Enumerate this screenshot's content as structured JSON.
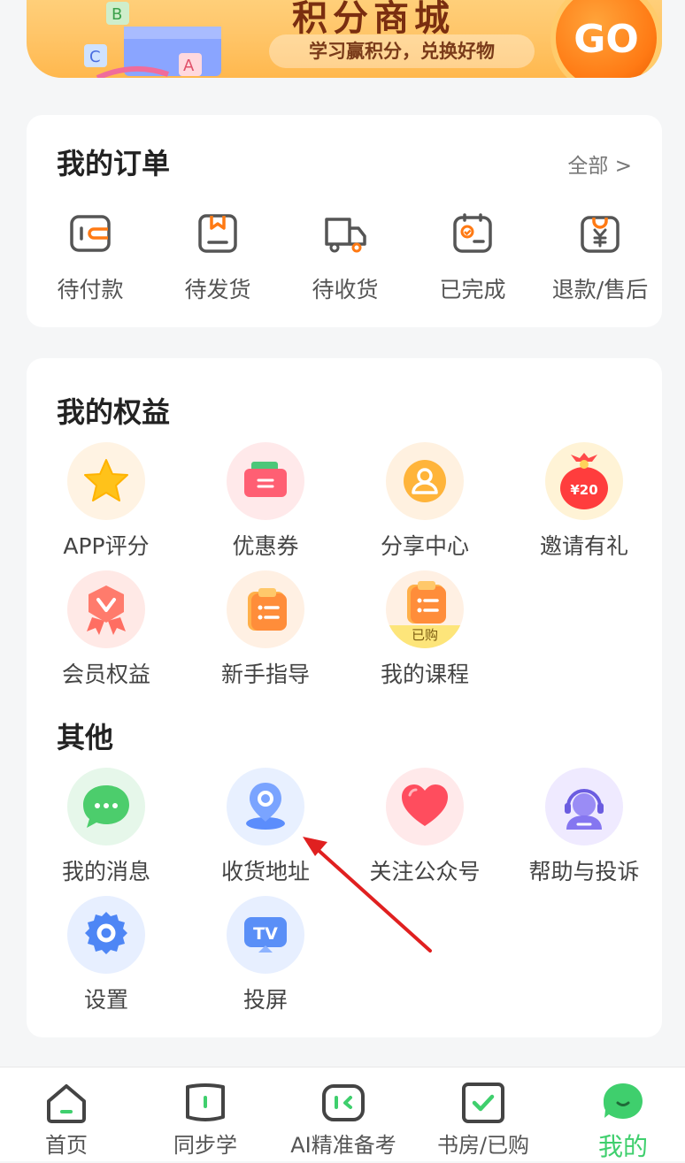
{
  "banner": {
    "title": "积分商城",
    "subtitle": "学习赢积分，兑换好物",
    "go_label": "GO"
  },
  "orders": {
    "title": "我的订单",
    "all_label": "全部 >",
    "items": [
      {
        "label": "待付款",
        "icon": "wallet-icon"
      },
      {
        "label": "待发货",
        "icon": "package-icon"
      },
      {
        "label": "待收货",
        "icon": "truck-icon"
      },
      {
        "label": "已完成",
        "icon": "check-clipboard-icon"
      },
      {
        "label": "退款/售后",
        "icon": "refund-bag-icon"
      }
    ]
  },
  "rights": {
    "title": "我的权益",
    "items": [
      {
        "label": "APP评分",
        "icon": "star-icon"
      },
      {
        "label": "优惠券",
        "icon": "coupon-icon"
      },
      {
        "label": "分享中心",
        "icon": "share-person-icon"
      },
      {
        "label": "邀请有礼",
        "icon": "red-envelope-icon",
        "badge": "¥20"
      },
      {
        "label": "会员权益",
        "icon": "vip-badge-icon"
      },
      {
        "label": "新手指导",
        "icon": "guide-clipboard-icon"
      },
      {
        "label": "我的课程",
        "icon": "course-icon",
        "badge": "已购"
      }
    ]
  },
  "others": {
    "title": "其他",
    "items": [
      {
        "label": "我的消息",
        "icon": "chat-bubble-icon"
      },
      {
        "label": "收货地址",
        "icon": "location-pin-icon"
      },
      {
        "label": "关注公众号",
        "icon": "heart-icon"
      },
      {
        "label": "帮助与投诉",
        "icon": "headset-support-icon"
      },
      {
        "label": "设置",
        "icon": "gear-icon"
      },
      {
        "label": "投屏",
        "icon": "tv-cast-icon"
      }
    ]
  },
  "tabbar": {
    "items": [
      {
        "label": "首页",
        "icon": "home-icon"
      },
      {
        "label": "同步学",
        "icon": "book-icon"
      },
      {
        "label": "AI精准备考",
        "icon": "ai-screen-icon"
      },
      {
        "label": "书房/已购",
        "icon": "bookshelf-check-icon"
      },
      {
        "label": "我的",
        "icon": "profile-face-icon",
        "active": true
      }
    ],
    "active_color": "#3fcf6d"
  },
  "colors": {
    "accent_green": "#3fcf6d",
    "annotation_arrow": "#e02020",
    "banner_orange": "#ff7a14"
  }
}
